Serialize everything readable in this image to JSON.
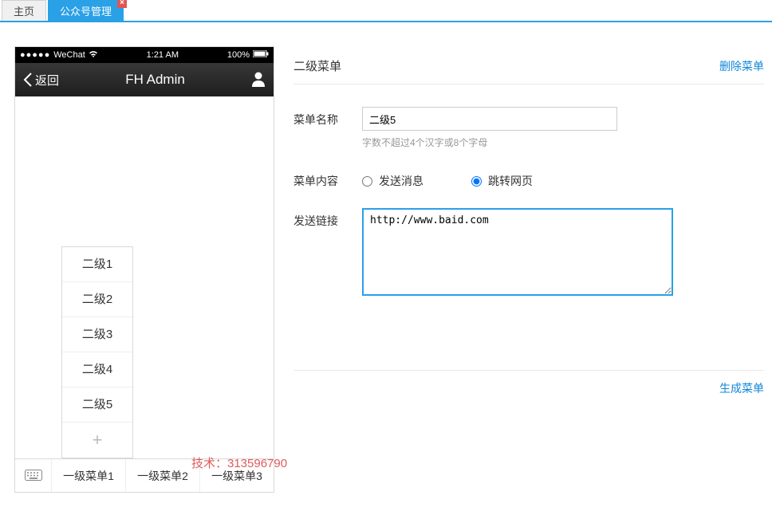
{
  "tabs": {
    "home": "主页",
    "active": "公众号管理"
  },
  "phone": {
    "status_carrier": "WeChat",
    "status_time": "1:21 AM",
    "status_battery": "100%",
    "back_label": "返回",
    "title": "FH Admin",
    "sub_items": [
      "二级1",
      "二级2",
      "二级3",
      "二级4",
      "二级5"
    ],
    "bottom": [
      "一级菜单1",
      "一级菜单2",
      "一级菜单3"
    ]
  },
  "form": {
    "header_title": "二级菜单",
    "delete_label": "删除菜单",
    "name_label": "菜单名称",
    "name_value": "二级5",
    "name_hint": "字数不超过4个汉字或8个字母",
    "content_label": "菜单内容",
    "radio_send": "发送消息",
    "radio_link": "跳转网页",
    "link_label": "发送链接",
    "link_value": "http://www.baid.com",
    "generate_label": "生成菜单"
  },
  "watermark": "技术：313596790"
}
